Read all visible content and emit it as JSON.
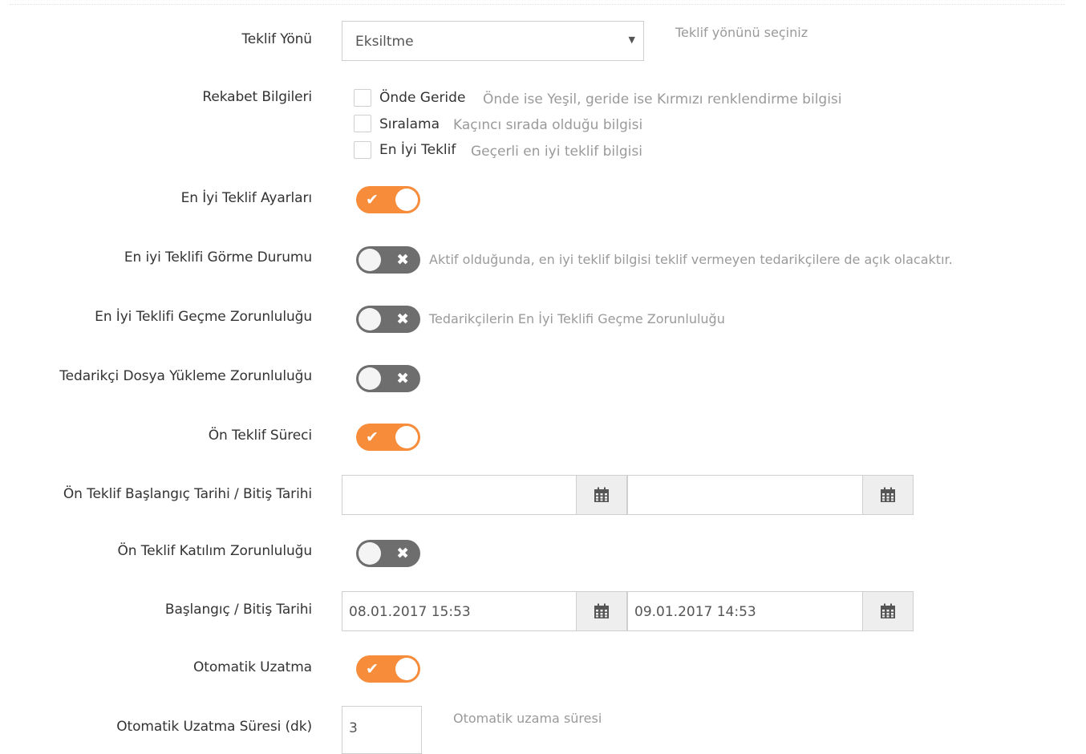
{
  "form": {
    "bid_direction": {
      "label": "Teklif Yönü",
      "value": "Eksiltme",
      "dropdown_icon": "triangle-down",
      "help": "Teklif yönünü seçiniz"
    },
    "competition_info": {
      "label": "Rekabet Bilgileri",
      "options": [
        {
          "label": "Önde Geride",
          "help": "Önde ise Yeşil, geride ise Kırmızı renklendirme bilgisi",
          "checked": false
        },
        {
          "label": "Sıralama",
          "help": "Kaçıncı sırada olduğu bilgisi",
          "checked": false
        },
        {
          "label": "En İyi Teklif",
          "help": "Geçerli en iyi teklif bilgisi",
          "checked": false
        }
      ]
    },
    "best_bid_settings": {
      "label": "En İyi Teklif Ayarları",
      "on": true
    },
    "best_bid_visibility": {
      "label": "En iyi Teklifi Görme Durumu",
      "on": false,
      "help": "Aktif olduğunda, en iyi teklif bilgisi teklif vermeyen tedarikçilere de açık olacaktır."
    },
    "beat_best_bid": {
      "label": "En İyi Teklifi Geçme Zorunluluğu",
      "on": false,
      "help": "Tedarikçilerin En İyi Teklifi Geçme Zorunluluğu"
    },
    "supplier_upload": {
      "label": "Tedarikçi Dosya Yükleme Zorunluluğu",
      "on": false
    },
    "pre_bid_process": {
      "label": "Ön Teklif Süreci",
      "on": true
    },
    "pre_bid_dates": {
      "label": "Ön Teklif Başlangıç Tarihi / Bitiş Tarihi",
      "start": "",
      "end": "",
      "icon": "calendar-icon"
    },
    "pre_bid_participation": {
      "label": "Ön Teklif Katılım Zorunluluğu",
      "on": false
    },
    "dates": {
      "label": "Başlangıç / Bitiş Tarihi",
      "start": "08.01.2017 15:53",
      "end": "09.01.2017 14:53",
      "icon": "calendar-icon"
    },
    "auto_extend": {
      "label": "Otomatik Uzatma",
      "on": true
    },
    "auto_extend_duration": {
      "label": "Otomatik Uzatma Süresi (dk)",
      "value": "3",
      "help": "Otomatik uzama süresi"
    }
  },
  "colors": {
    "toggle_on": "#f78c3b",
    "toggle_off": "#6e6e6e",
    "help_text": "#9a9a9a",
    "border": "#cfcfcf",
    "addon_bg": "#eeeeee"
  },
  "icons": {
    "toggle_on_symbol": "✔",
    "toggle_off_symbol": "✖",
    "select_arrow": "▼"
  }
}
